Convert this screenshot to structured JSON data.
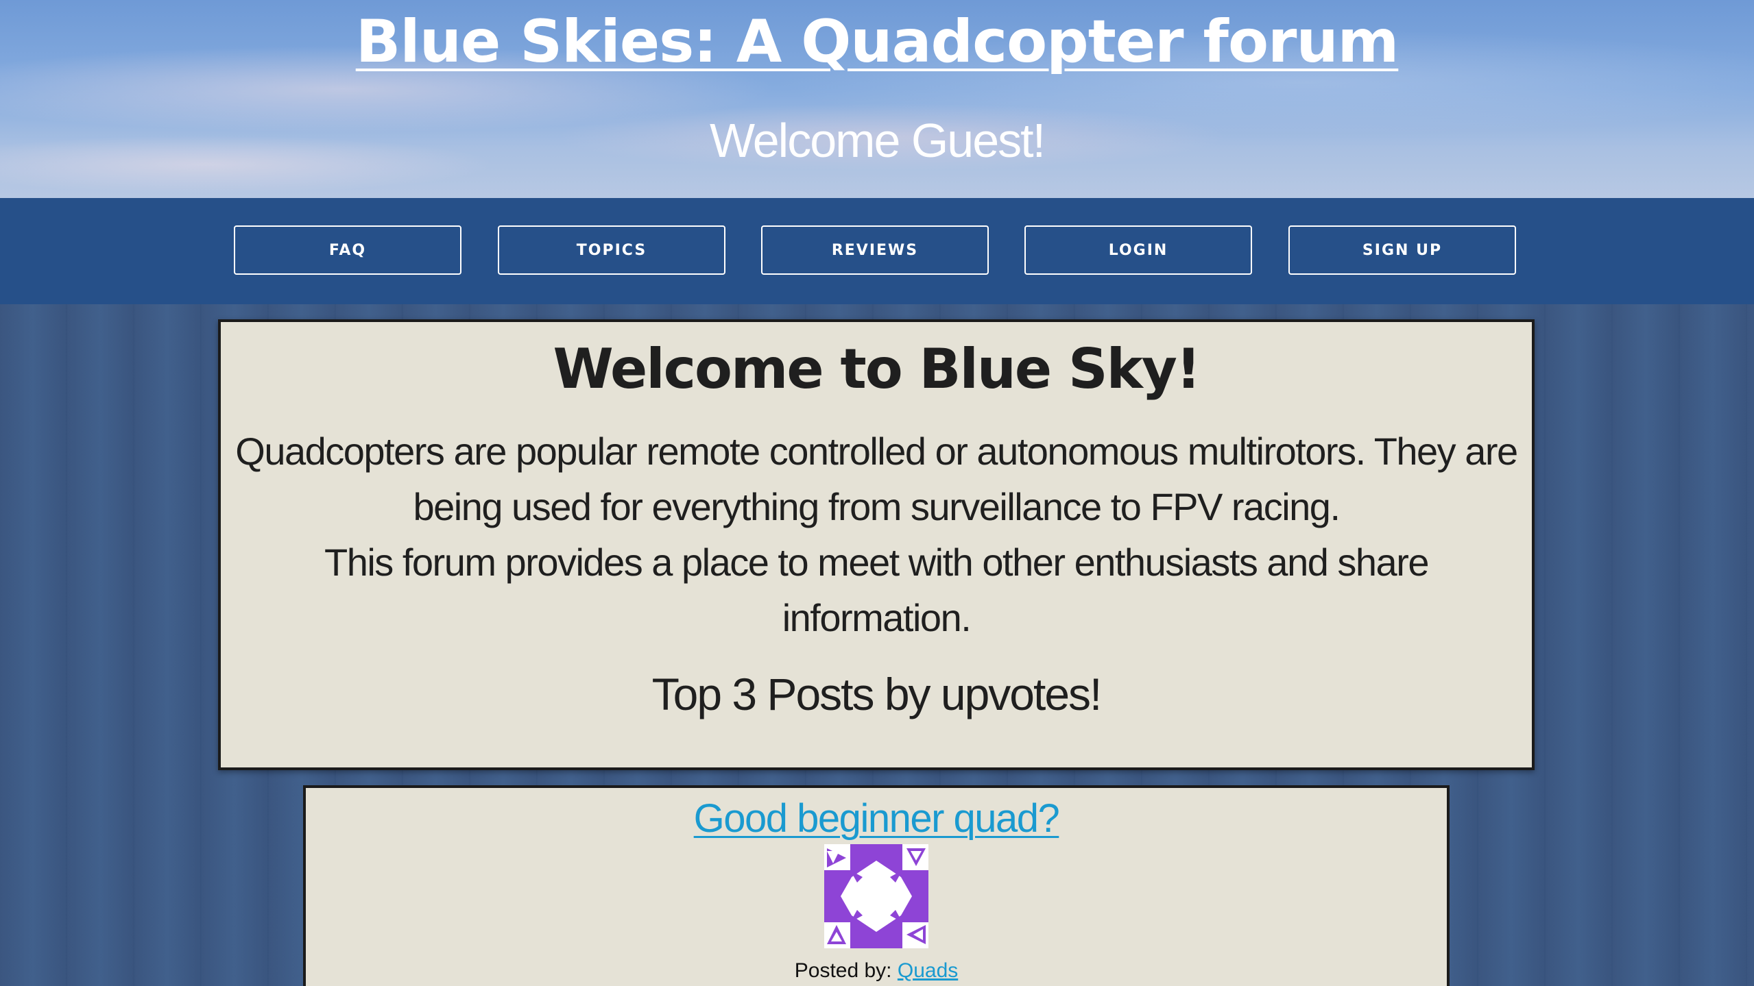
{
  "header": {
    "site_title": "Blue Skies: A Quadcopter forum",
    "welcome_message": "Welcome Guest!"
  },
  "nav": {
    "items": [
      {
        "label": "FAQ"
      },
      {
        "label": "TOPICS"
      },
      {
        "label": "REVIEWS"
      },
      {
        "label": "LOGIN"
      },
      {
        "label": "SIGN UP"
      }
    ]
  },
  "welcome_panel": {
    "heading": "Welcome to Blue Sky!",
    "intro": "Quadcopters are popular remote controlled or autonomous multirotors. They are being used for everything from surveillance to FPV racing.",
    "purpose": "This forum provides a place to meet with other enthusiasts and share information.",
    "top_posts_heading": "Top 3 Posts by upvotes!"
  },
  "posts": [
    {
      "title": "Good beginner quad?",
      "posted_by_label": "Posted by:",
      "author": "Quads",
      "avatar_icon": "identicon-avatar",
      "avatar_color": "#8e44d6"
    }
  ],
  "colors": {
    "nav_background": "#265089",
    "panel_background": "#e5e2d6",
    "link": "#1a9ad0"
  }
}
